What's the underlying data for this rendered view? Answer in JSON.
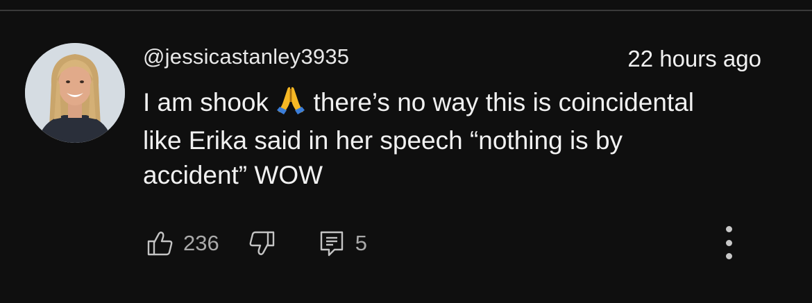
{
  "comment": {
    "author": "@jessicastanley3935",
    "timestamp": "22 hours ago",
    "text_lines": [
      {
        "before_emoji": "I am shook ",
        "after_emoji": " there’s no way this is coincidental"
      },
      "like Erika said in her speech “nothing is by",
      "accident” WOW"
    ],
    "emoji": "folded-hands-emoji"
  },
  "actions": {
    "like_count": "236",
    "reply_count": "5"
  },
  "icons": {
    "like": "thumbs-up-icon",
    "dislike": "thumbs-down-icon",
    "reply": "reply-comment-icon",
    "more": "more-vertical-icon"
  },
  "colors": {
    "background": "#0f0f0f",
    "text_primary": "#f1f1f1",
    "text_secondary": "#aaaaaa"
  }
}
